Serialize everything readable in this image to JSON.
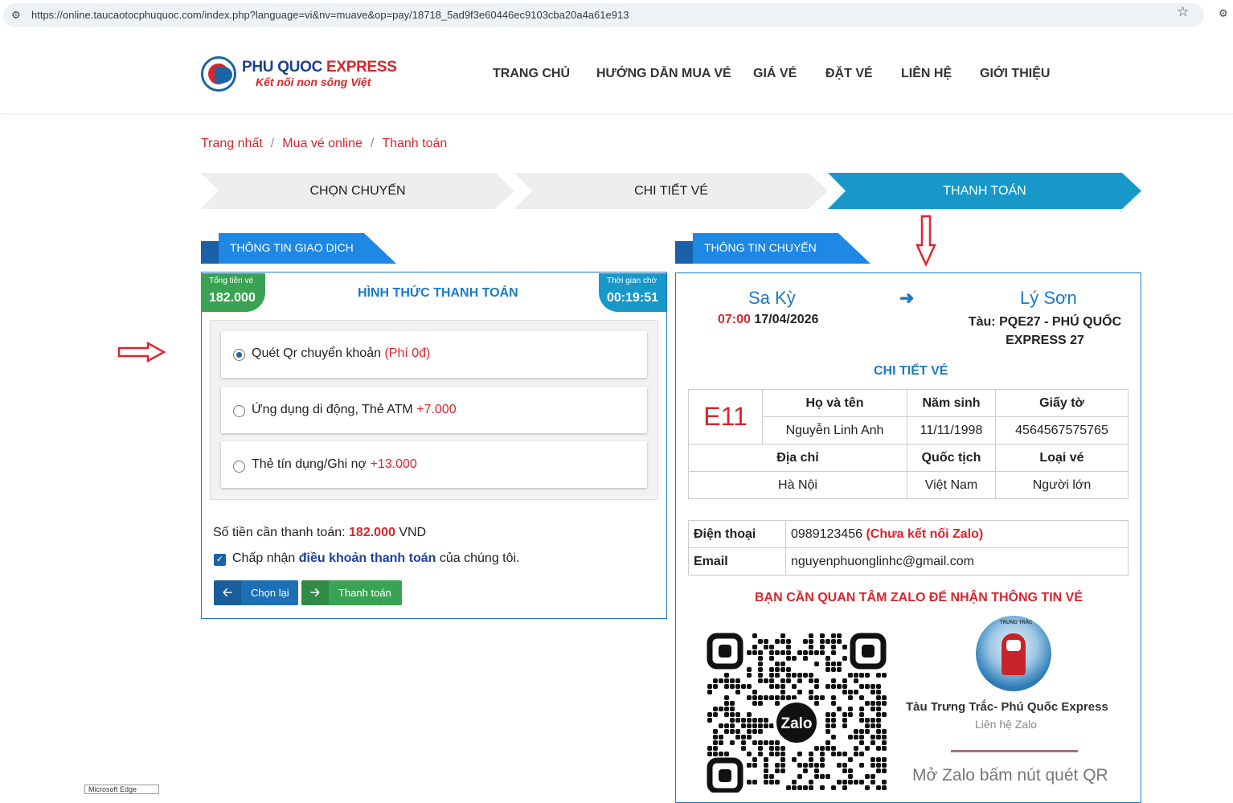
{
  "browser": {
    "url": "https://online.taucaotocphuquoc.com/index.php?language=vi&nv=muave&op=pay/18718_5ad9f3e60446ec9103cba20a4a61e913",
    "taskbar_label": "Microsoft Edge"
  },
  "brand": {
    "name_part1": "PHU QUOC",
    "name_part2": "EXPRESS",
    "slogan": "Kết nối non sông Việt"
  },
  "nav": {
    "items": [
      "TRANG CHỦ",
      "HƯỚNG DẪN MUA VÉ",
      "GIÁ VÉ",
      "ĐẶT VÉ",
      "LIÊN HỆ",
      "GIỚI THIỆU"
    ]
  },
  "breadcrumb": [
    "Trang nhất",
    "Mua vé online",
    "Thanh toán"
  ],
  "steps": [
    {
      "label": "CHỌN CHUYẾN",
      "active": false
    },
    {
      "label": "CHI TIẾT VÉ",
      "active": false
    },
    {
      "label": "THANH TOÁN",
      "active": true
    }
  ],
  "transaction": {
    "tab_title": "THÔNG TIN GIAO DỊCH",
    "total_label": "Tổng tiền vé",
    "total_value": "182.000",
    "wait_label": "Thời gian chờ",
    "wait_value": "00:19:51",
    "heading": "HÌNH THỨC THANH TOÁN",
    "options": [
      {
        "label": "Quét Qr chuyển khoản",
        "fee": "(Phí 0đ)",
        "selected": true
      },
      {
        "label": "Ứng dụng di động, Thẻ ATM",
        "fee": "+7.000",
        "selected": false
      },
      {
        "label": "Thẻ tín dụng/Ghi nợ",
        "fee": "+13.000",
        "selected": false
      }
    ],
    "amount_label": "Số tiền cần thanh toán:",
    "amount_value": "182.000",
    "amount_unit": "VND",
    "agree_prefix": "Chấp nhận",
    "agree_link": "điều khoản thanh toán",
    "agree_suffix": "của chúng tôi.",
    "agree_checked": true,
    "back_button": "Chọn lại",
    "pay_button": "Thanh toán"
  },
  "trip": {
    "tab_title": "THÔNG TIN CHUYẾN",
    "from": "Sa Kỳ",
    "to": "Lý Sơn",
    "depart_time": "07:00",
    "depart_date": "17/04/2026",
    "ship_prefix": "Tàu:",
    "ship_name": "PQE27 - PHÚ QUỐC EXPRESS 27",
    "ticket_title": "CHI TIẾT VÉ",
    "seat": "E11",
    "headers_1": [
      "Họ và tên",
      "Năm sinh",
      "Giấy tờ"
    ],
    "values_1": [
      "Nguyễn Linh Anh",
      "11/11/1998",
      "4564567575765"
    ],
    "headers_2": [
      "Địa chỉ",
      "Quốc tịch",
      "Loại vé"
    ],
    "values_2": [
      "Hà Nội",
      "Việt Nam",
      "Người lớn"
    ],
    "phone_label": "Điện thoại",
    "phone_value": "0989123456",
    "phone_note": "(Chưa kết nối Zalo)",
    "email_label": "Email",
    "email_value": "nguyenphuonglinhc@gmail.com",
    "zalo_alert": "BẠN CẦN QUAN TÂM ZALO ĐỂ NHẬN THÔNG TIN VÉ",
    "zalo_qr_logo": "Zalo",
    "zalo_avatar_caption": "TRƯNG TRẮC",
    "zalo_name": "Tàu Trưng Trắc- Phú Quốc Express",
    "zalo_contact": "Liên hệ Zalo",
    "zalo_hint": "Mở Zalo bấm nút quét QR"
  },
  "colors": {
    "accent_blue": "#1c7ac4",
    "active_step": "#1798c9",
    "brand_red": "#d7262d",
    "badge_green": "#3aa353",
    "pay_button": "#3aa353",
    "back_button": "#1c6fb5"
  }
}
